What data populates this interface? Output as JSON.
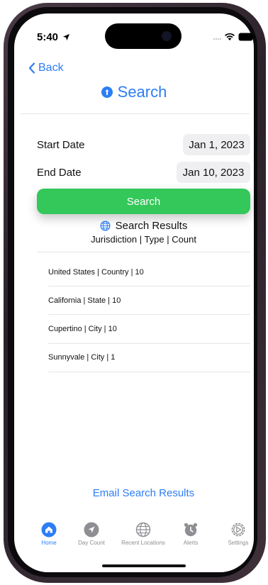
{
  "status_bar": {
    "time": "5:40"
  },
  "nav": {
    "back_label": "Back",
    "title": "Search"
  },
  "form": {
    "start_label": "Start Date",
    "start_value": "Jan 1, 2023",
    "end_label": "End Date",
    "end_value": "Jan 10, 2023",
    "search_button": "Search"
  },
  "results": {
    "title": "Search Results",
    "subtitle": "Jurisdiction | Type | Count",
    "rows": [
      "United States | Country |  10",
      "California | State | 10",
      "Cupertino | City |  10",
      "Sunnyvale | City |  1"
    ]
  },
  "email_link": "Email Search Results",
  "tabs": [
    {
      "label": "Home",
      "icon": "house-icon",
      "active": true
    },
    {
      "label": "Day Count",
      "icon": "location-arrow-icon",
      "active": false
    },
    {
      "label": "Recent Locations",
      "icon": "globe-icon",
      "active": false
    },
    {
      "label": "Alerts",
      "icon": "alarm-clock-icon",
      "active": false
    },
    {
      "label": "Settings",
      "icon": "gear-icon",
      "active": false
    }
  ],
  "colors": {
    "accent": "#2d7df6",
    "search_button": "#34c759",
    "inactive_tab": "#8e8e93"
  }
}
